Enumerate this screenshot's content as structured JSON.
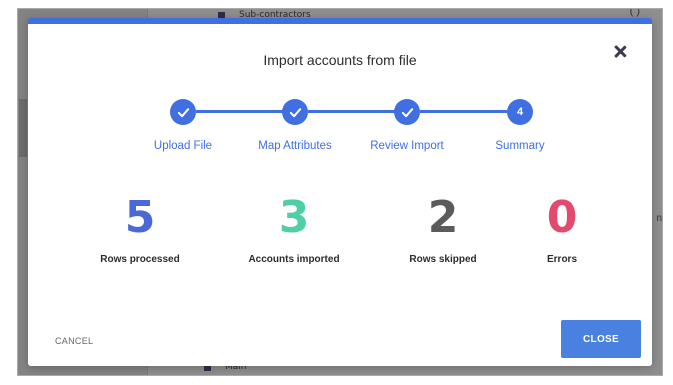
{
  "background": {
    "top_row_text": "Sub-contractors",
    "bottom_row_text": "Main",
    "paren_glyph": "( )",
    "side_letter": "n"
  },
  "modal": {
    "title": "Import accounts from file",
    "accent_color": "#3f6fe0",
    "steps": [
      {
        "label": "Upload File",
        "state": "done",
        "icon": "check-icon"
      },
      {
        "label": "Map Attributes",
        "state": "done",
        "icon": "check-icon"
      },
      {
        "label": "Review Import",
        "state": "done",
        "icon": "check-icon"
      },
      {
        "label": "Summary",
        "state": "current",
        "number": "4"
      }
    ],
    "stats": [
      {
        "value": "5",
        "label": "Rows processed",
        "color": "#4a68d8"
      },
      {
        "value": "3",
        "label": "Accounts imported",
        "color": "#4fd0a4"
      },
      {
        "value": "2",
        "label": "Rows skipped",
        "color": "#5b5b5b"
      },
      {
        "value": "0",
        "label": "Errors",
        "color": "#e34b6e"
      }
    ],
    "cancel_label": "CANCEL",
    "close_label": "CLOSE",
    "close_icon": "close-icon"
  }
}
